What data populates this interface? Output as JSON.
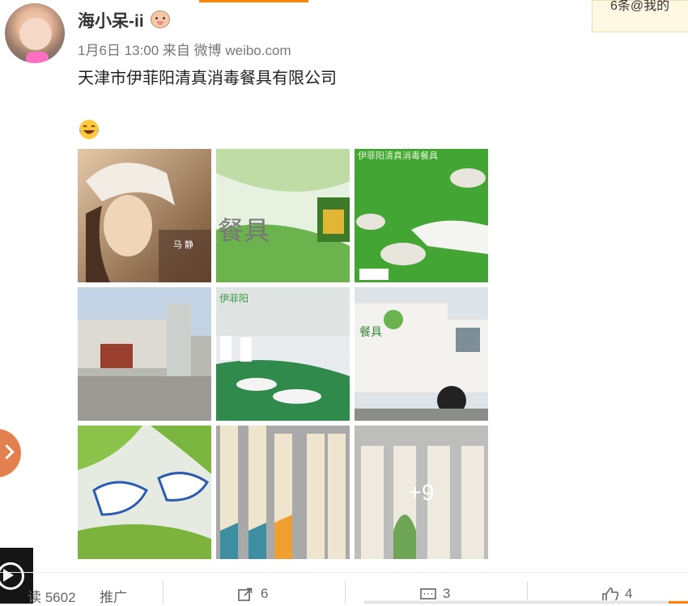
{
  "user": {
    "name": "海小呆-ii",
    "avatar_icon": "avatar-photo",
    "badge_icon": "monkey-badge-icon"
  },
  "post": {
    "meta": "1月6日 13:00 来自 微博 weibo.com",
    "text": "天津市伊菲阳清真消毒餐具有限公司",
    "emoji": "laughing-tears-emoji",
    "images": [
      {
        "kind": "portrait-woman-photo",
        "caption": "马 静"
      },
      {
        "kind": "green-tableware-ad",
        "caption": "餐具"
      },
      {
        "kind": "green-bowl-landscape",
        "caption": "伊菲阳清真消毒餐具"
      },
      {
        "kind": "factory-building-photo",
        "caption": ""
      },
      {
        "kind": "production-line-photo",
        "caption": "伊菲阳"
      },
      {
        "kind": "delivery-truck-photo",
        "caption": "餐具"
      },
      {
        "kind": "blue-white-porcelain-photo",
        "caption": ""
      },
      {
        "kind": "chopsticks-packaging-design",
        "caption": ""
      },
      {
        "kind": "packaging-design-more",
        "caption": ""
      }
    ],
    "more_count": "+9"
  },
  "notification": {
    "text": "6条@我的"
  },
  "actions": {
    "reads": "读 5602",
    "promote": "推广",
    "share_count": "6",
    "comment_count": "3",
    "like_count": "4"
  },
  "colors": {
    "accent": "#ff8200",
    "bubble": "#e38050"
  }
}
